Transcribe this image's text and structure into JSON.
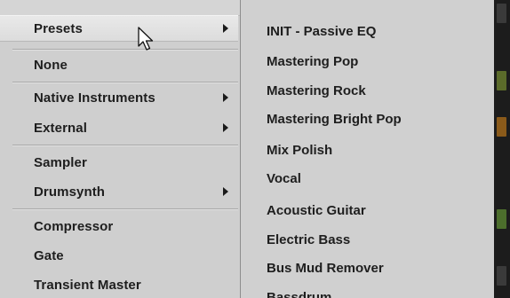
{
  "menu": {
    "items": [
      {
        "label": "Presets",
        "submenu": true
      },
      {
        "label": "None",
        "submenu": false
      },
      {
        "label": "Native Instruments",
        "submenu": true
      },
      {
        "label": "External",
        "submenu": true
      },
      {
        "label": "Sampler",
        "submenu": false
      },
      {
        "label": "Drumsynth",
        "submenu": true
      },
      {
        "label": "Compressor",
        "submenu": false
      },
      {
        "label": "Gate",
        "submenu": false
      },
      {
        "label": "Transient Master",
        "submenu": false
      }
    ]
  },
  "submenu": {
    "items": [
      {
        "label": "INIT - Passive EQ"
      },
      {
        "label": "Mastering Pop"
      },
      {
        "label": "Mastering Rock"
      },
      {
        "label": "Mastering Bright Pop"
      },
      {
        "label": "Mix Polish"
      },
      {
        "label": "Vocal"
      },
      {
        "label": "Acoustic Guitar"
      },
      {
        "label": "Electric Bass"
      },
      {
        "label": "Bus Mud Remover"
      },
      {
        "label": "Bassdrum"
      }
    ]
  },
  "icons": {
    "cursor": "mouse-pointer-icon",
    "submenu_arrow": "chevron-right-icon"
  },
  "colors": {
    "menu_background": "#cfcfcf",
    "highlight": "#e4e4e4",
    "text": "#1e1e1e"
  }
}
